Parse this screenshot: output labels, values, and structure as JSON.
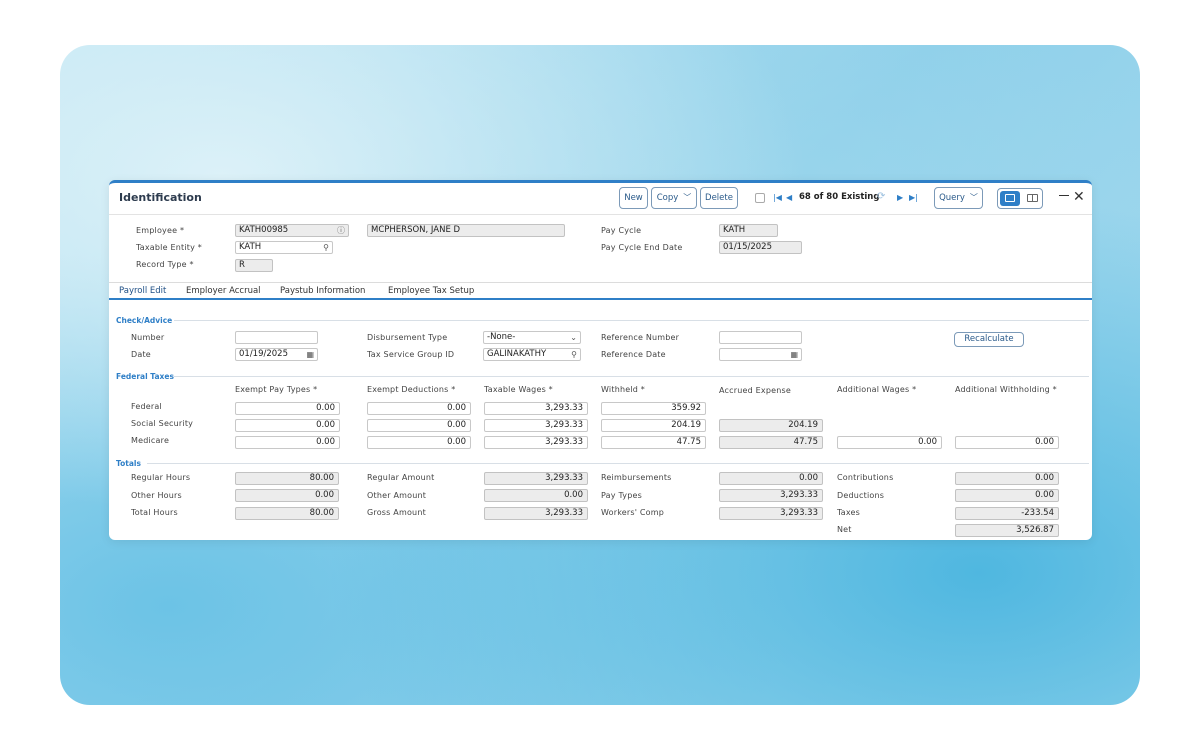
{
  "window": {
    "title": "Identification"
  },
  "toolbar": {
    "new_label": "New",
    "copy_label": "Copy",
    "delete_label": "Delete",
    "record_count": "68 of 80 Existing",
    "query_label": "Query"
  },
  "header": {
    "employee_label": "Employee",
    "employee_id": "KATH00985",
    "employee_name": "MCPHERSON, JANE D",
    "taxable_entity_label": "Taxable Entity",
    "taxable_entity": "KATH",
    "record_type_label": "Record Type",
    "record_type": "R",
    "pay_cycle_label": "Pay Cycle",
    "pay_cycle": "KATH",
    "pay_cycle_end_label": "Pay Cycle End Date",
    "pay_cycle_end": "01/15/2025"
  },
  "tabs": [
    "Payroll Edit",
    "Employer Accrual",
    "Paystub Information",
    "Employee Tax Setup"
  ],
  "check": {
    "section_label": "Check/Advice",
    "number_label": "Number",
    "number": "",
    "date_label": "Date",
    "date": "01/19/2025",
    "disbursement_label": "Disbursement Type",
    "disbursement": "-None-",
    "tax_service_label": "Tax Service Group ID",
    "tax_service": "GALINAKATHY",
    "reference_number_label": "Reference Number",
    "reference_number": "",
    "reference_date_label": "Reference Date",
    "reference_date": "",
    "recalculate_label": "Recalculate"
  },
  "federal": {
    "section_label": "Federal Taxes",
    "columns": [
      "Exempt Pay Types",
      "Exempt Deductions",
      "Taxable Wages",
      "Withheld",
      "Accrued Expense",
      "Additional Wages",
      "Additional Withholding"
    ],
    "rows": [
      {
        "label": "Federal",
        "exempt_pay": "0.00",
        "exempt_ded": "0.00",
        "taxable": "3,293.33",
        "withheld": "359.92"
      },
      {
        "label": "Social Security",
        "exempt_pay": "0.00",
        "exempt_ded": "0.00",
        "taxable": "3,293.33",
        "withheld": "204.19",
        "accrued": "204.19"
      },
      {
        "label": "Medicare",
        "exempt_pay": "0.00",
        "exempt_ded": "0.00",
        "taxable": "3,293.33",
        "withheld": "47.75",
        "accrued": "47.75",
        "add_wages": "0.00",
        "add_withholding": "0.00"
      }
    ]
  },
  "totals": {
    "section_label": "Totals",
    "regular_hours_label": "Regular Hours",
    "regular_hours": "80.00",
    "other_hours_label": "Other Hours",
    "other_hours": "0.00",
    "total_hours_label": "Total Hours",
    "total_hours": "80.00",
    "regular_amount_label": "Regular Amount",
    "regular_amount": "3,293.33",
    "other_amount_label": "Other Amount",
    "other_amount": "0.00",
    "gross_amount_label": "Gross Amount",
    "gross_amount": "3,293.33",
    "reimbursements_label": "Reimbursements",
    "reimbursements": "0.00",
    "pay_types_label": "Pay Types",
    "pay_types": "3,293.33",
    "workers_comp_label": "Workers' Comp",
    "workers_comp": "3,293.33",
    "contributions_label": "Contributions",
    "contributions": "0.00",
    "deductions_label": "Deductions",
    "deductions": "0.00",
    "taxes_label": "Taxes",
    "taxes": "-233.54",
    "net_label": "Net",
    "net": "3,526.87"
  }
}
